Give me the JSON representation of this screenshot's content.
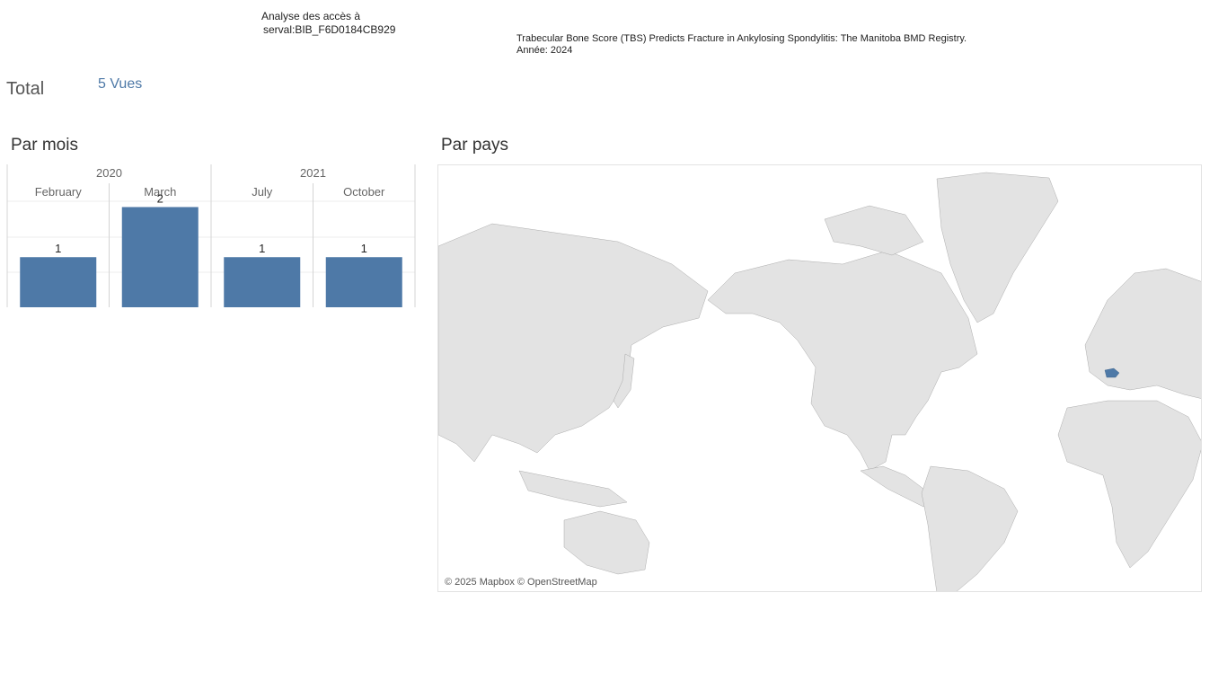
{
  "header": {
    "title_line1": "Analyse des accès à",
    "title_line2": "serval:BIB_F6D0184CB929"
  },
  "publication": {
    "title": "Trabecular Bone Score (TBS) Predicts Fracture in Ankylosing Spondylitis: The Manitoba BMD Registry.",
    "year_text": "Année: 2024"
  },
  "total": {
    "label": "Total",
    "value": "5 Vues"
  },
  "sections": {
    "by_month": "Par mois",
    "by_country": "Par pays"
  },
  "map": {
    "credit": "© 2025 Mapbox © OpenStreetMap",
    "highlighted_country": "Switzerland",
    "highlight_color": "#4e79a7"
  },
  "colors": {
    "bar": "#4e79a7",
    "accent": "#4e79a7"
  },
  "chart_data": {
    "type": "bar",
    "title": "",
    "groups": [
      {
        "label": "2020",
        "categories": [
          "February",
          "March"
        ]
      },
      {
        "label": "2021",
        "categories": [
          "July",
          "October"
        ]
      }
    ],
    "categories": [
      "February",
      "March",
      "July",
      "October"
    ],
    "values": [
      1,
      2,
      1,
      1
    ],
    "ylim": [
      0,
      2
    ],
    "grid": true,
    "data_labels": true
  }
}
